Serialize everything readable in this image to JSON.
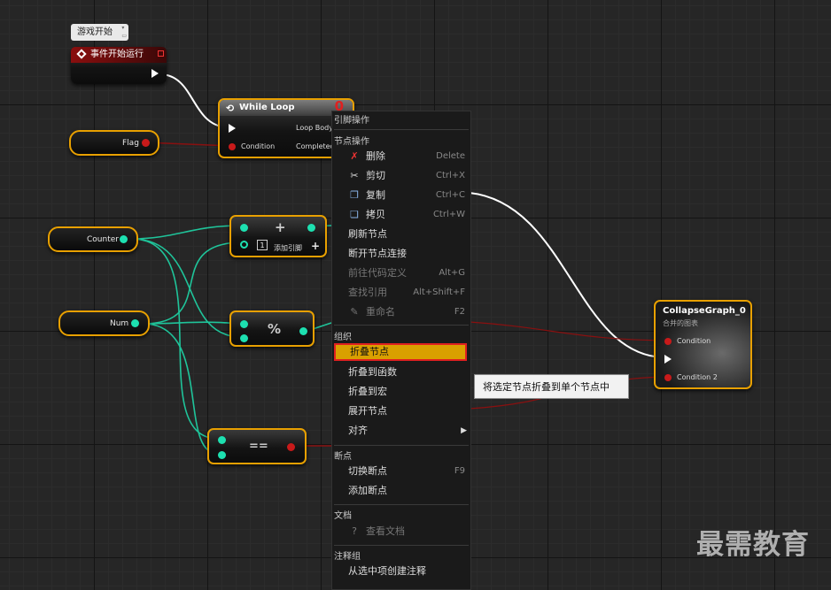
{
  "comment_bubble": "游戏开始",
  "event_node": {
    "title": "事件开始运行"
  },
  "flag_var": {
    "label": "Flag"
  },
  "counter_var": {
    "label": "Counter"
  },
  "num_var": {
    "label": "Num"
  },
  "while_loop": {
    "title": "While Loop",
    "pin_condition": "Condition",
    "pin_loop_body": "Loop Body",
    "pin_completed": "Completed"
  },
  "add_node": {
    "op": "+",
    "add_pin": "添加引脚",
    "plus": "+"
  },
  "mod_node": {
    "op": "%"
  },
  "eq_node": {
    "op": "=="
  },
  "collapse_node": {
    "title": "CollapseGraph_0",
    "subtitle": "合并的图表",
    "pin_condition": "Condition",
    "pin_condition2": "Condition 2"
  },
  "menu": {
    "header_pin": "引脚操作",
    "sec_node": "节点操作",
    "items_node": [
      {
        "label": "删除",
        "shortcut": "Delete",
        "icon": "delete-icon"
      },
      {
        "label": "剪切",
        "shortcut": "Ctrl+X",
        "icon": "scissors-icon"
      },
      {
        "label": "复制",
        "shortcut": "Ctrl+C",
        "icon": "copy-icon"
      },
      {
        "label": "拷贝",
        "shortcut": "Ctrl+W",
        "icon": "duplicate-icon"
      },
      {
        "label": "刷新节点",
        "shortcut": ""
      },
      {
        "label": "断开节点连接",
        "shortcut": ""
      },
      {
        "label": "前往代码定义",
        "shortcut": "Alt+G"
      },
      {
        "label": "查找引用",
        "shortcut": "Alt+Shift+F"
      },
      {
        "label": "重命名",
        "shortcut": "F2",
        "icon": "rename-icon"
      }
    ],
    "sec_org": "组织",
    "collapse_node": "折叠节点",
    "collapse_func": "折叠到函数",
    "collapse_macro": "折叠到宏",
    "expand_node": "展开节点",
    "align": "对齐",
    "sec_breakpoint": "断点",
    "toggle_bp": "切换断点",
    "toggle_bp_sc": "F9",
    "add_bp": "添加断点",
    "sec_doc": "文档",
    "view_doc": "查看文档",
    "sec_comment": "注释组",
    "create_comment": "从选中项创建注释"
  },
  "tooltip": "将选定节点折叠到单个节点中",
  "watermark": "最需教育",
  "colors": {
    "selection": "#e8a000",
    "bool_pin": "#c81a1a",
    "int_pin": "#1de0b0",
    "menu_highlight": "#d9a000"
  }
}
